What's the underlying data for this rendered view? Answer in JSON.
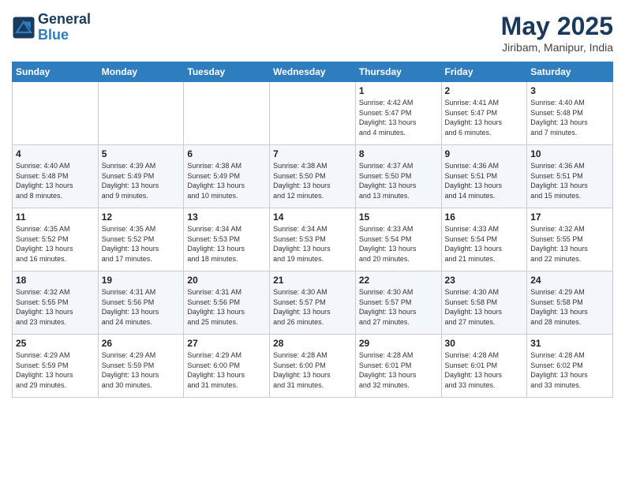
{
  "header": {
    "logo_line1": "General",
    "logo_line2": "Blue",
    "month": "May 2025",
    "location": "Jiribam, Manipur, India"
  },
  "days_of_week": [
    "Sunday",
    "Monday",
    "Tuesday",
    "Wednesday",
    "Thursday",
    "Friday",
    "Saturday"
  ],
  "weeks": [
    [
      {
        "num": "",
        "info": ""
      },
      {
        "num": "",
        "info": ""
      },
      {
        "num": "",
        "info": ""
      },
      {
        "num": "",
        "info": ""
      },
      {
        "num": "1",
        "info": "Sunrise: 4:42 AM\nSunset: 5:47 PM\nDaylight: 13 hours\nand 4 minutes."
      },
      {
        "num": "2",
        "info": "Sunrise: 4:41 AM\nSunset: 5:47 PM\nDaylight: 13 hours\nand 6 minutes."
      },
      {
        "num": "3",
        "info": "Sunrise: 4:40 AM\nSunset: 5:48 PM\nDaylight: 13 hours\nand 7 minutes."
      }
    ],
    [
      {
        "num": "4",
        "info": "Sunrise: 4:40 AM\nSunset: 5:48 PM\nDaylight: 13 hours\nand 8 minutes."
      },
      {
        "num": "5",
        "info": "Sunrise: 4:39 AM\nSunset: 5:49 PM\nDaylight: 13 hours\nand 9 minutes."
      },
      {
        "num": "6",
        "info": "Sunrise: 4:38 AM\nSunset: 5:49 PM\nDaylight: 13 hours\nand 10 minutes."
      },
      {
        "num": "7",
        "info": "Sunrise: 4:38 AM\nSunset: 5:50 PM\nDaylight: 13 hours\nand 12 minutes."
      },
      {
        "num": "8",
        "info": "Sunrise: 4:37 AM\nSunset: 5:50 PM\nDaylight: 13 hours\nand 13 minutes."
      },
      {
        "num": "9",
        "info": "Sunrise: 4:36 AM\nSunset: 5:51 PM\nDaylight: 13 hours\nand 14 minutes."
      },
      {
        "num": "10",
        "info": "Sunrise: 4:36 AM\nSunset: 5:51 PM\nDaylight: 13 hours\nand 15 minutes."
      }
    ],
    [
      {
        "num": "11",
        "info": "Sunrise: 4:35 AM\nSunset: 5:52 PM\nDaylight: 13 hours\nand 16 minutes."
      },
      {
        "num": "12",
        "info": "Sunrise: 4:35 AM\nSunset: 5:52 PM\nDaylight: 13 hours\nand 17 minutes."
      },
      {
        "num": "13",
        "info": "Sunrise: 4:34 AM\nSunset: 5:53 PM\nDaylight: 13 hours\nand 18 minutes."
      },
      {
        "num": "14",
        "info": "Sunrise: 4:34 AM\nSunset: 5:53 PM\nDaylight: 13 hours\nand 19 minutes."
      },
      {
        "num": "15",
        "info": "Sunrise: 4:33 AM\nSunset: 5:54 PM\nDaylight: 13 hours\nand 20 minutes."
      },
      {
        "num": "16",
        "info": "Sunrise: 4:33 AM\nSunset: 5:54 PM\nDaylight: 13 hours\nand 21 minutes."
      },
      {
        "num": "17",
        "info": "Sunrise: 4:32 AM\nSunset: 5:55 PM\nDaylight: 13 hours\nand 22 minutes."
      }
    ],
    [
      {
        "num": "18",
        "info": "Sunrise: 4:32 AM\nSunset: 5:55 PM\nDaylight: 13 hours\nand 23 minutes."
      },
      {
        "num": "19",
        "info": "Sunrise: 4:31 AM\nSunset: 5:56 PM\nDaylight: 13 hours\nand 24 minutes."
      },
      {
        "num": "20",
        "info": "Sunrise: 4:31 AM\nSunset: 5:56 PM\nDaylight: 13 hours\nand 25 minutes."
      },
      {
        "num": "21",
        "info": "Sunrise: 4:30 AM\nSunset: 5:57 PM\nDaylight: 13 hours\nand 26 minutes."
      },
      {
        "num": "22",
        "info": "Sunrise: 4:30 AM\nSunset: 5:57 PM\nDaylight: 13 hours\nand 27 minutes."
      },
      {
        "num": "23",
        "info": "Sunrise: 4:30 AM\nSunset: 5:58 PM\nDaylight: 13 hours\nand 27 minutes."
      },
      {
        "num": "24",
        "info": "Sunrise: 4:29 AM\nSunset: 5:58 PM\nDaylight: 13 hours\nand 28 minutes."
      }
    ],
    [
      {
        "num": "25",
        "info": "Sunrise: 4:29 AM\nSunset: 5:59 PM\nDaylight: 13 hours\nand 29 minutes."
      },
      {
        "num": "26",
        "info": "Sunrise: 4:29 AM\nSunset: 5:59 PM\nDaylight: 13 hours\nand 30 minutes."
      },
      {
        "num": "27",
        "info": "Sunrise: 4:29 AM\nSunset: 6:00 PM\nDaylight: 13 hours\nand 31 minutes."
      },
      {
        "num": "28",
        "info": "Sunrise: 4:28 AM\nSunset: 6:00 PM\nDaylight: 13 hours\nand 31 minutes."
      },
      {
        "num": "29",
        "info": "Sunrise: 4:28 AM\nSunset: 6:01 PM\nDaylight: 13 hours\nand 32 minutes."
      },
      {
        "num": "30",
        "info": "Sunrise: 4:28 AM\nSunset: 6:01 PM\nDaylight: 13 hours\nand 33 minutes."
      },
      {
        "num": "31",
        "info": "Sunrise: 4:28 AM\nSunset: 6:02 PM\nDaylight: 13 hours\nand 33 minutes."
      }
    ]
  ]
}
